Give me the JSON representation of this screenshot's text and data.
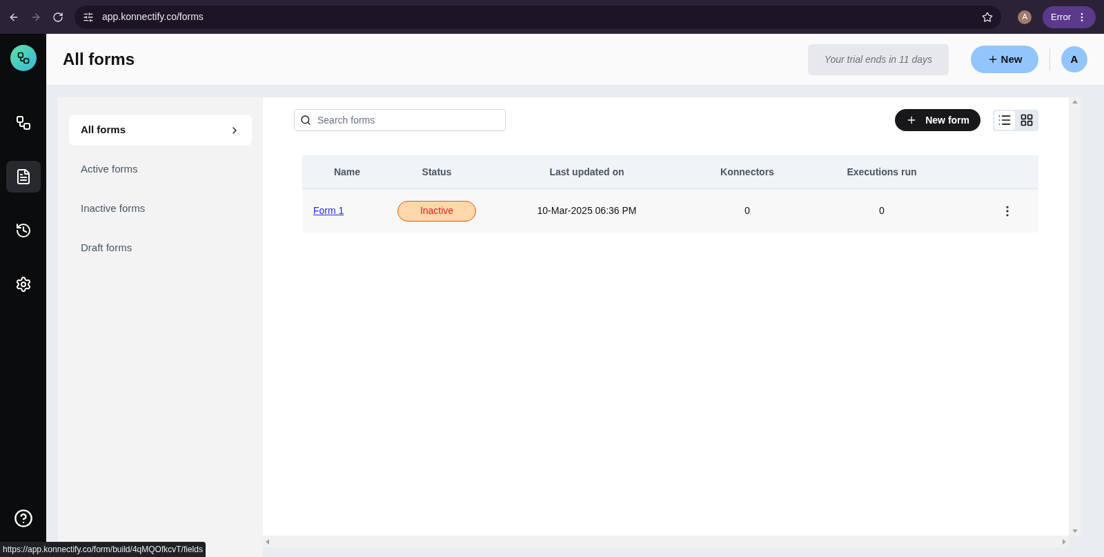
{
  "browser": {
    "url": "app.konnectify.co/forms",
    "profile_initial": "A",
    "error_label": "Error",
    "status_url": "https://app.konnectify.co/form/build/4qMQOfkcvT/fields"
  },
  "rail": [
    {
      "kind": "connections",
      "selected": false
    },
    {
      "kind": "forms",
      "selected": true
    },
    {
      "kind": "history",
      "selected": false
    },
    {
      "kind": "settings",
      "selected": false
    }
  ],
  "header": {
    "title": "All forms",
    "trial_note": "Your trial ends in 11 days",
    "new_button": "New",
    "avatar_initial": "A"
  },
  "subnav": [
    {
      "label": "All forms",
      "selected": true
    },
    {
      "label": "Active forms",
      "selected": false
    },
    {
      "label": "Inactive forms",
      "selected": false
    },
    {
      "label": "Draft forms",
      "selected": false
    }
  ],
  "search": {
    "placeholder": "Search forms"
  },
  "new_form_button": "New form",
  "views": [
    {
      "kind": "list",
      "selected": true
    },
    {
      "kind": "grid",
      "selected": false
    }
  ],
  "table": {
    "columns": [
      "Name",
      "Status",
      "Last updated on",
      "Konnectors",
      "Executions run"
    ],
    "rows": [
      {
        "name": "Form 1",
        "status": "Inactive",
        "active": false,
        "updated": "10-Mar-2025 06:36 PM",
        "konnectors": "0",
        "executions": "0"
      }
    ]
  }
}
